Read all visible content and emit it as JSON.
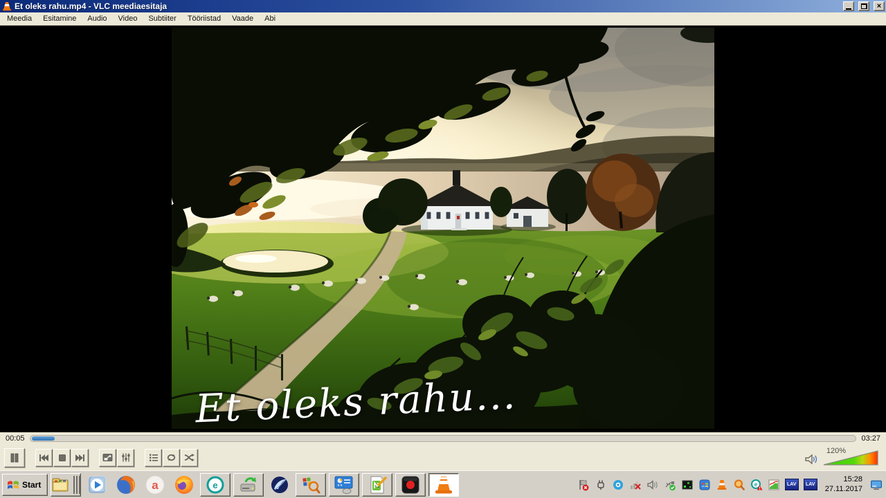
{
  "titlebar": {
    "title": "Et oleks rahu.mp4 - VLC meediaesitaja"
  },
  "menubar": {
    "items": [
      "Meedia",
      "Esitamine",
      "Audio",
      "Video",
      "Subtiiter",
      "Tööriistad",
      "Vaade",
      "Abi"
    ]
  },
  "video": {
    "caption": "Et oleks rahu..."
  },
  "seekbar": {
    "elapsed": "00:05",
    "total": "03:27",
    "progress_percent": 2.8
  },
  "volume": {
    "label": "120%"
  },
  "taskbar": {
    "start_label": "Start",
    "clock": {
      "time": "15:28",
      "date": "27.11.2017"
    },
    "lav_label": "LAV",
    "amigo_letter": "a",
    "eset_letter": "e"
  },
  "icons": {
    "titlebar": [
      "vlc-cone-icon"
    ],
    "window_buttons": [
      "minimize-icon",
      "restore-icon",
      "close-icon"
    ],
    "controls": [
      "pause-icon",
      "previous-icon",
      "stop-icon",
      "next-icon",
      "fullscreen-icon",
      "extended-settings-icon",
      "playlist-icon",
      "loop-icon",
      "shuffle-icon",
      "speaker-icon",
      "volume-wedge"
    ],
    "quick_launch": [
      "file-manager",
      "windows-media-player",
      "firefox-old",
      "amigo-browser",
      "firefox",
      "blue-feather"
    ],
    "task_buttons": [
      "eset",
      "driver-updater",
      "windows-search",
      "display-settings",
      "notepad-plus-plus",
      "screen-recorder",
      "vlc-active"
    ],
    "tray": [
      "security-flag-alert",
      "plug",
      "blue-dot",
      "network-disconnected",
      "tray-volume",
      "usb-safely-remove",
      "network-monitor",
      "windows-update",
      "vlc-tray",
      "orange-search",
      "eset-alert",
      "stats-chart",
      "lav-filter",
      "lav-filter",
      "show-desktop"
    ]
  },
  "colors": {
    "titlebar_gradient_left": "#0b2a7a",
    "titlebar_gradient_right": "#8fb0dc",
    "progress_blue": "#2f74b4",
    "volume_green": "#3fd10a",
    "volume_orange": "#ff9000",
    "volume_red": "#ff2d00",
    "chrome_gray": "#ece9d8",
    "taskbar_gray": "#d4d0c8"
  }
}
